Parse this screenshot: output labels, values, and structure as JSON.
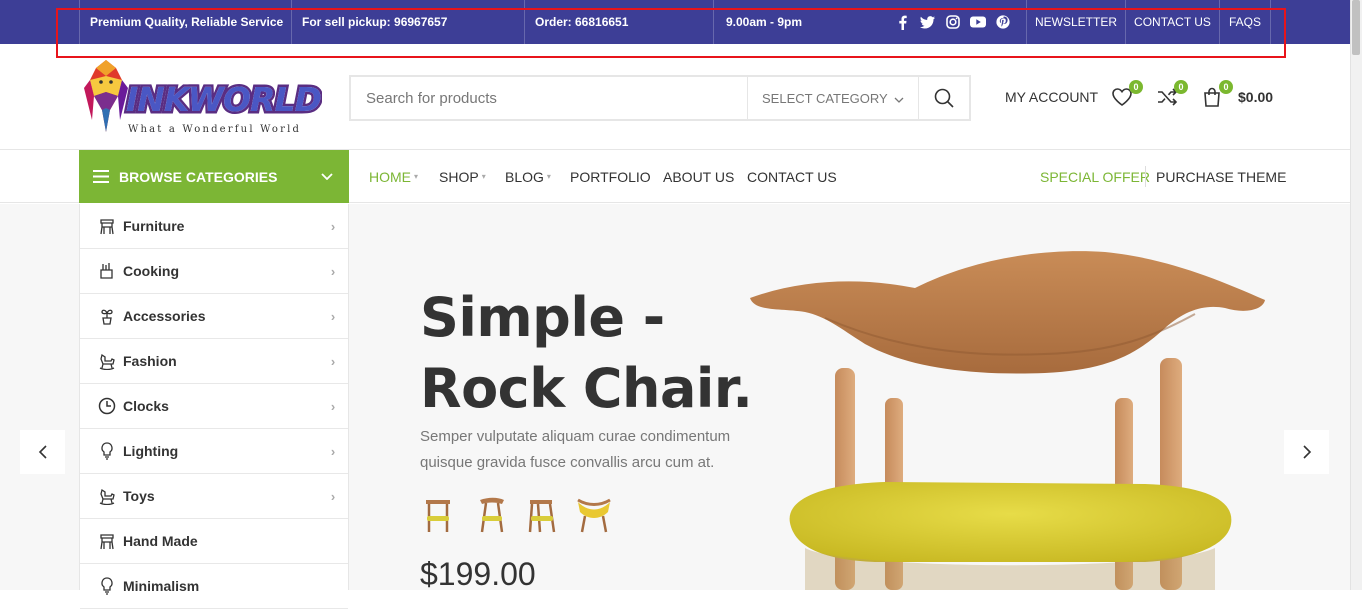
{
  "topbar": {
    "info": [
      "Premium Quality, Reliable Service",
      "For sell pickup: 96967657",
      "Order: 66816651",
      "9.00am - 9pm"
    ],
    "social": [
      "facebook-icon",
      "twitter-icon",
      "instagram-icon",
      "youtube-icon",
      "pinterest-icon"
    ],
    "links": [
      "NEWSLETTER",
      "CONTACT US",
      "FAQS"
    ],
    "bg_color": "#3d3e96"
  },
  "logo": {
    "brand": "INKWORLD",
    "tagline": "What a Wonderful World"
  },
  "search": {
    "placeholder": "Search for products",
    "category": "SELECT CATEGORY"
  },
  "header": {
    "my_account": "MY ACCOUNT",
    "wishlist_count": "0",
    "compare_count": "0",
    "cart_count": "0",
    "cart_total": "$0.00"
  },
  "nav": {
    "browse": "BROWSE CATEGORIES",
    "items": [
      "HOME",
      "SHOP",
      "BLOG",
      "PORTFOLIO",
      "ABOUT US",
      "CONTACT US"
    ],
    "special_offer": "SPECIAL OFFER",
    "purchase": "PURCHASE THEME",
    "accent": "#7cb635"
  },
  "categories": [
    {
      "label": "Furniture",
      "icon": "chair-icon"
    },
    {
      "label": "Cooking",
      "icon": "cooking-icon"
    },
    {
      "label": "Accessories",
      "icon": "plant-icon"
    },
    {
      "label": "Fashion",
      "icon": "rocking-horse-icon"
    },
    {
      "label": "Clocks",
      "icon": "clock-icon"
    },
    {
      "label": "Lighting",
      "icon": "bulb-icon"
    },
    {
      "label": "Toys",
      "icon": "rocking-horse-icon"
    },
    {
      "label": "Hand Made",
      "icon": "chair-icon"
    },
    {
      "label": "Minimalism",
      "icon": "bulb-icon"
    }
  ],
  "slide": {
    "title_line1": "Simple -",
    "title_line2": "Rock Chair.",
    "description": "Semper vulputate aliquam curae condimentum quisque gravida fusce convallis arcu cum at.",
    "price": "$199.00"
  }
}
